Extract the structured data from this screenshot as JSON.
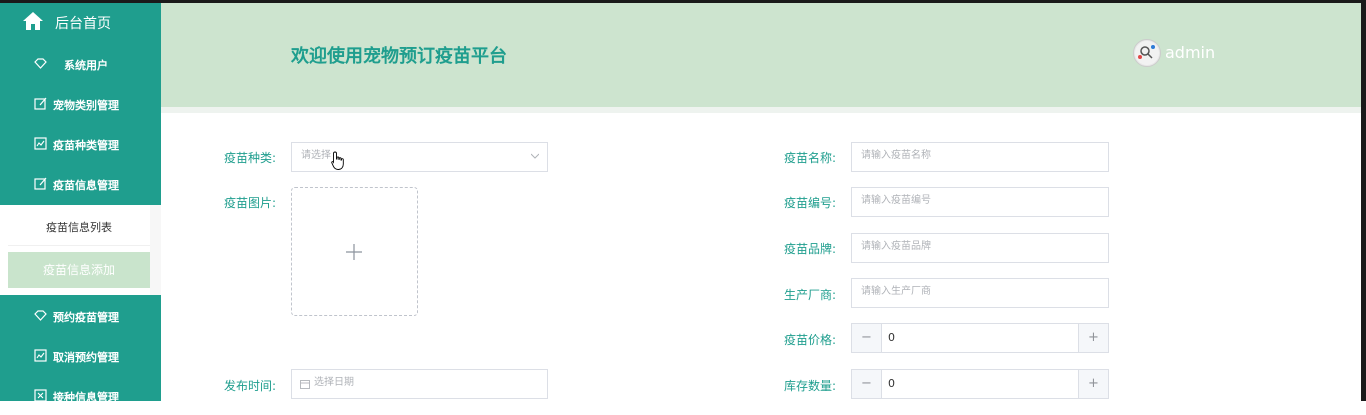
{
  "sidebar": {
    "home_label": "后台首页",
    "items": [
      {
        "label": "系统用户",
        "icon": "diamond-icon"
      },
      {
        "label": "宠物类别管理",
        "icon": "edit-icon"
      },
      {
        "label": "疫苗种类管理",
        "icon": "chart-icon"
      },
      {
        "label": "疫苗信息管理",
        "icon": "edit-icon"
      },
      {
        "label": "预约疫苗管理",
        "icon": "diamond-icon"
      },
      {
        "label": "取消预约管理",
        "icon": "chart-icon"
      },
      {
        "label": "接种信息管理",
        "icon": "close-box-icon"
      }
    ],
    "sub_items": [
      "疫苗信息列表",
      "疫苗信息添加"
    ]
  },
  "header": {
    "title": "欢迎使用宠物预订疫苗平台",
    "user": "admin"
  },
  "form": {
    "vaccine_type": {
      "label": "疫苗种类:",
      "placeholder": "请选择"
    },
    "vaccine_image": {
      "label": "疫苗图片:"
    },
    "publish_time": {
      "label": "发布时间:",
      "placeholder": "选择日期"
    },
    "vaccine_name": {
      "label": "疫苗名称:",
      "placeholder": "请输入疫苗名称"
    },
    "vaccine_code": {
      "label": "疫苗编号:",
      "placeholder": "请输入疫苗编号"
    },
    "vaccine_brand": {
      "label": "疫苗品牌:",
      "placeholder": "请输入疫苗品牌"
    },
    "manufacturer": {
      "label": "生产厂商:",
      "placeholder": "请输入生产厂商"
    },
    "price": {
      "label": "疫苗价格:",
      "value": "0"
    },
    "stock": {
      "label": "库存数量:",
      "value": "0"
    }
  },
  "colors": {
    "accent": "#1f9e8e",
    "header_bg": "#cde4cf",
    "active_sub": "#c9e4cc"
  }
}
